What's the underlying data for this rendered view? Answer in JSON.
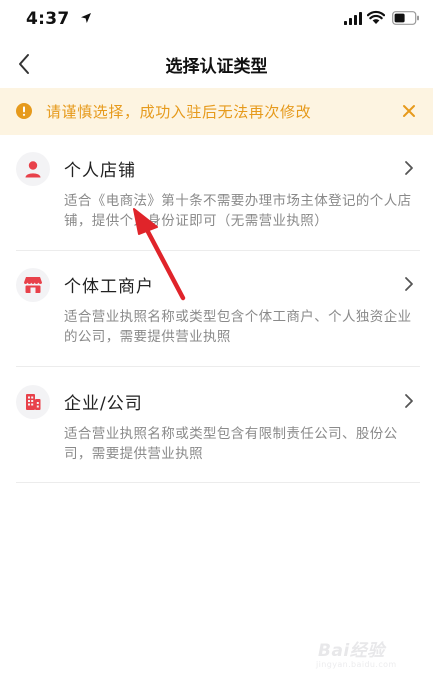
{
  "status_bar": {
    "time": "4:37"
  },
  "nav": {
    "title": "选择认证类型"
  },
  "warning": {
    "text": "请谨慎选择，成功入驻后无法再次修改",
    "color": "#e69a1c",
    "background": "#fdf4e1"
  },
  "options": [
    {
      "icon": "person-icon",
      "title": "个人店铺",
      "desc": "适合《电商法》第十条不需要办理市场主体登记的个人店铺，提供个人身份证即可（无需营业执照）"
    },
    {
      "icon": "storefront-icon",
      "title": "个体工商户",
      "desc": "适合营业执照名称或类型包含个体工商户、个人独资企业的公司，需要提供营业执照"
    },
    {
      "icon": "building-icon",
      "title": "企业/公司",
      "desc": "适合营业执照名称或类型包含有限制责任公司、股份公司，需要提供营业执照"
    }
  ],
  "colors": {
    "accent_red": "#e8414a",
    "annotation_arrow": "#e0242a"
  },
  "watermark": {
    "brand": "Bai经验",
    "sub": "jingyan.baidu.com"
  }
}
